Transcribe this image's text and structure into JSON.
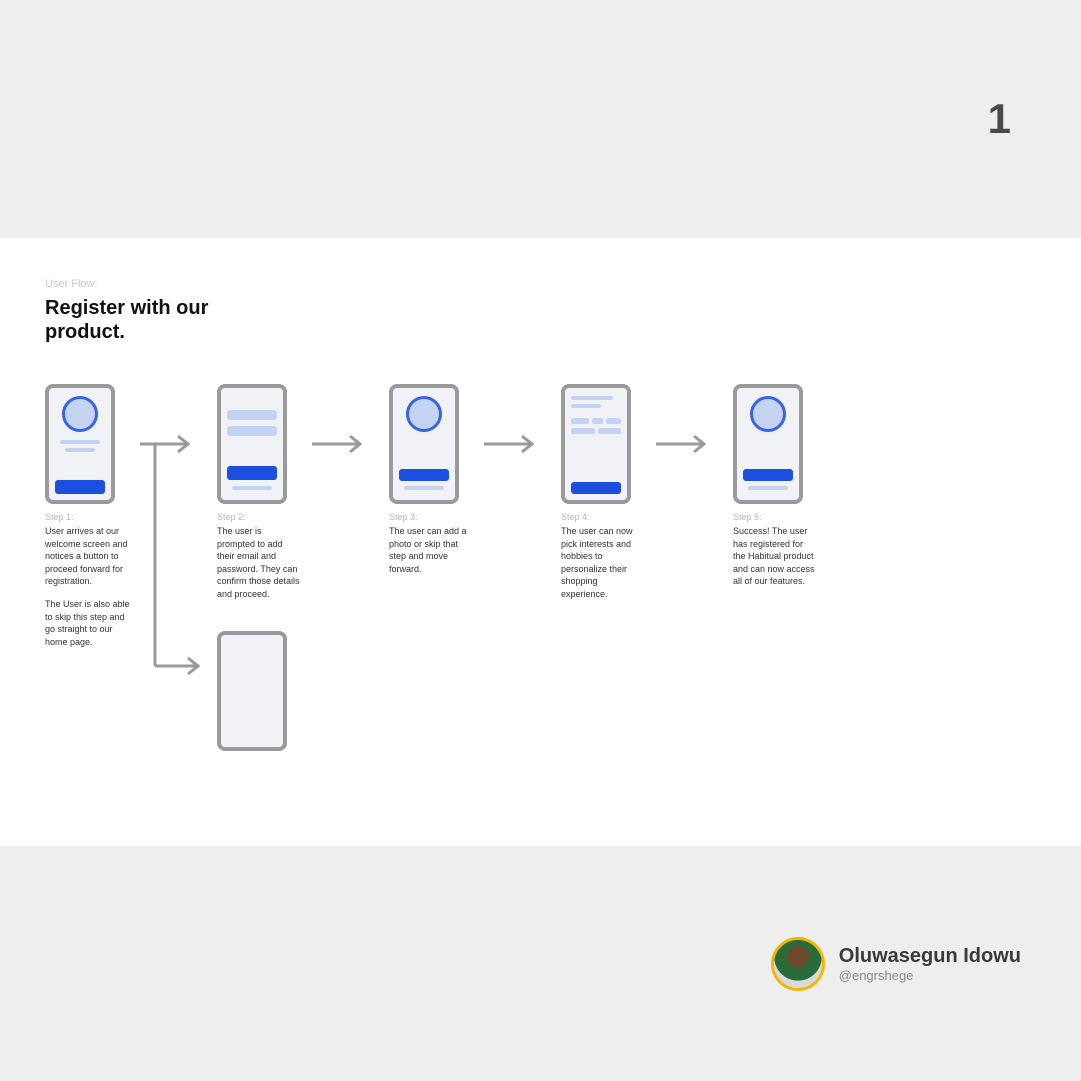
{
  "page_number": "1",
  "kicker": "User Flow:",
  "title": "Register with our product.",
  "steps": [
    {
      "label": "Step 1:",
      "desc": "User arrives at our welcome screen and notices a button to proceed forward for registration.",
      "desc2": "The User is also able to skip this step and go straight to our home page."
    },
    {
      "label": "Step 2:",
      "desc": "The user is prompted to add their email and password. They can confirm those details and proceed."
    },
    {
      "label": "Step 3:",
      "desc": "The user can add a photo or skip that step and move forward."
    },
    {
      "label": "Step 4:",
      "desc": "The user can now pick interests and hobbies to personalize their shopping experience."
    },
    {
      "label": "Step 5:",
      "desc": "Success! The user has registered for the Habitual product and can now access all of our features."
    }
  ],
  "author": {
    "name": "Oluwasegun Idowu",
    "handle": "@engrshege"
  }
}
